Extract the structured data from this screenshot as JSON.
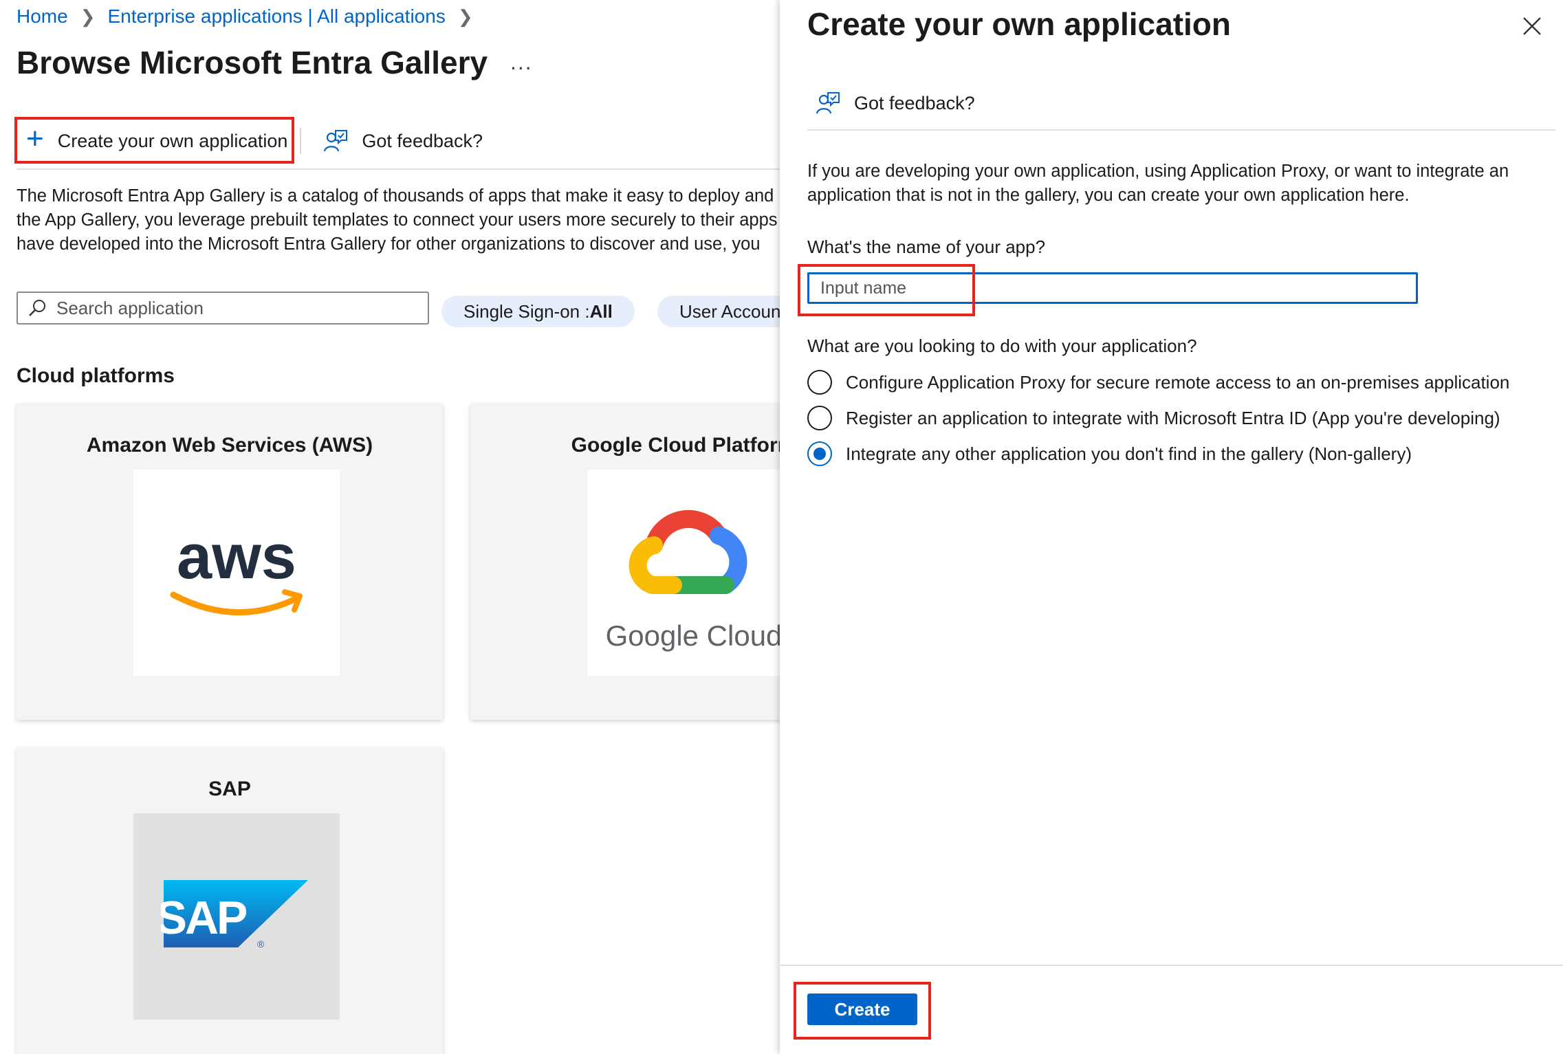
{
  "breadcrumb": {
    "items": [
      "Home",
      "Enterprise applications | All applications"
    ]
  },
  "page": {
    "title": "Browse Microsoft Entra Gallery",
    "more": "..."
  },
  "toolbar": {
    "create_label": "Create your own application",
    "feedback_label": "Got feedback?"
  },
  "description": {
    "lines": [
      "The Microsoft Entra App Gallery is a catalog of thousands of apps that make it easy to deploy and",
      "the App Gallery, you leverage prebuilt templates to connect your users more securely to their apps",
      "have developed into the Microsoft Entra Gallery for other organizations to discover and use, you"
    ]
  },
  "search": {
    "placeholder": "Search application"
  },
  "filters": {
    "sso_label": "Single Sign-on : ",
    "sso_value": "All",
    "user_account_label": "User Account"
  },
  "section": {
    "title": "Cloud platforms"
  },
  "cards": [
    {
      "title": "Amazon Web Services (AWS)",
      "logo_text": "aws"
    },
    {
      "title": "Google Cloud Platform",
      "logo_text": "Google Cloud"
    },
    {
      "title": "SAP",
      "logo_text": "SAP"
    }
  ],
  "panel": {
    "title": "Create your own application",
    "feedback_label": "Got feedback?",
    "description": "If you are developing your own application, using Application Proxy, or want to integrate an application that is not in the gallery, you can create your own application here.",
    "name_label": "What's the name of your app?",
    "name_placeholder": "Input name",
    "name_value": "",
    "purpose_label": "What are you looking to do with your application?",
    "options": [
      {
        "label": "Configure Application Proxy for secure remote access to an on-premises application",
        "checked": false
      },
      {
        "label": "Register an application to integrate with Microsoft Entra ID (App you're developing)",
        "checked": false
      },
      {
        "label": "Integrate any other application you don't find in the gallery (Non-gallery)",
        "checked": true
      }
    ],
    "create_label": "Create"
  },
  "colors": {
    "accent": "#0064c8",
    "highlight": "#e8231c",
    "pill_bg": "#e6eefb"
  }
}
